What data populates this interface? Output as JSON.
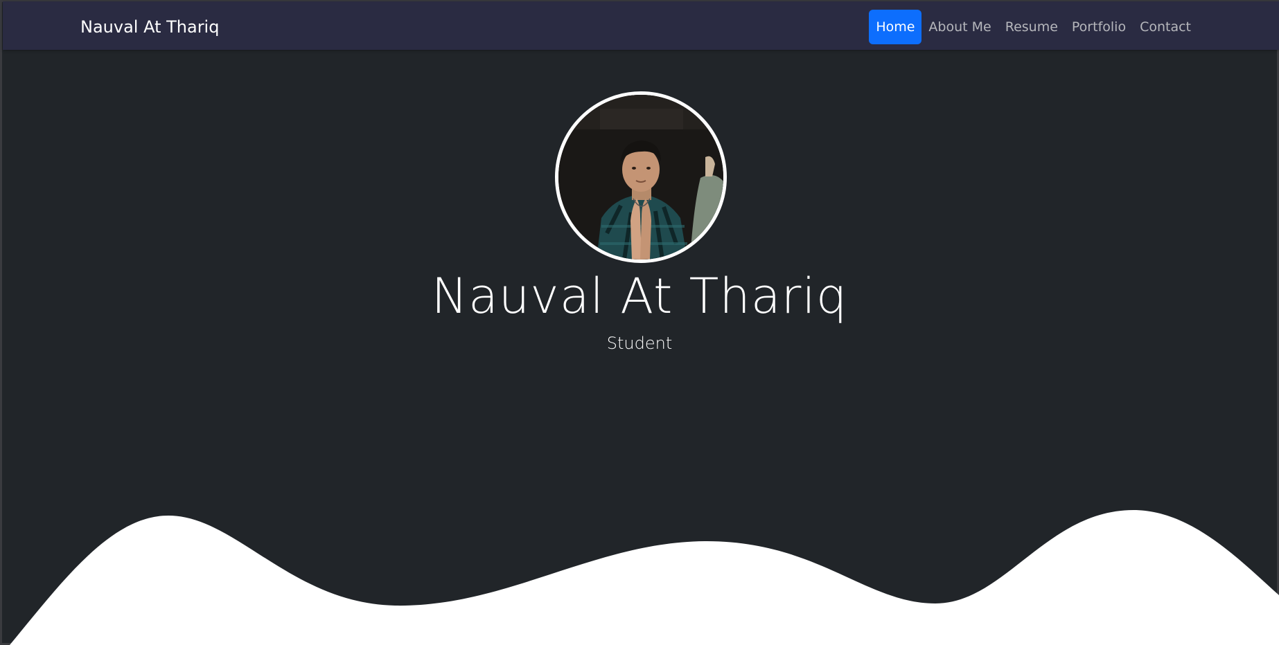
{
  "navbar": {
    "brand": "Nauval At Thariq",
    "items": [
      {
        "label": "Home",
        "active": true
      },
      {
        "label": "About Me",
        "active": false
      },
      {
        "label": "Resume",
        "active": false
      },
      {
        "label": "Portfolio",
        "active": false
      },
      {
        "label": "Contact",
        "active": false
      }
    ]
  },
  "hero": {
    "name": "Nauval At Thariq",
    "subtitle": "Student"
  },
  "colors": {
    "accent": "#0d6efd",
    "background": "#212529",
    "navbar": "#2a2b42",
    "wave": "#ffffff"
  }
}
